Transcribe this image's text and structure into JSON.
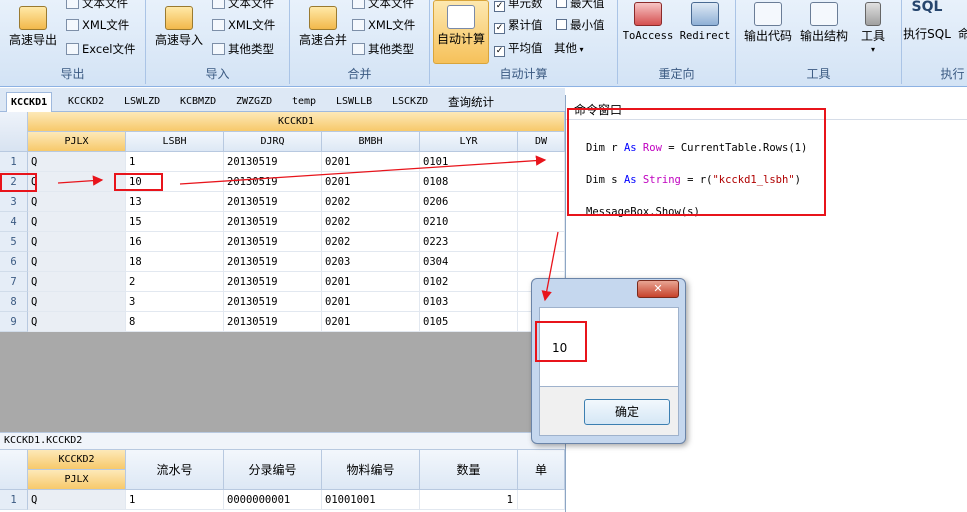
{
  "ribbon": {
    "export": {
      "label": "导出",
      "big": "高速导出",
      "small": [
        "文本文件",
        "XML文件",
        "Excel文件"
      ]
    },
    "import": {
      "label": "导入",
      "big": "高速导入",
      "small": [
        "文本文件",
        "XML文件",
        "其他类型"
      ]
    },
    "merge": {
      "label": "合并",
      "big": "高速合并",
      "small": [
        "文本文件",
        "XML文件",
        "其他类型"
      ]
    },
    "autocalc": {
      "label": "自动计算",
      "big": "自动计算",
      "checks": [
        "单元数",
        "累计值",
        "平均值"
      ],
      "checks2": [
        "最大值",
        "最小值"
      ],
      "other": "其他"
    },
    "redirect": {
      "label": "重定向",
      "buttons": [
        "ToAccess",
        "Redirect"
      ]
    },
    "tools": {
      "label": "工具",
      "buttons": [
        "输出代码",
        "输出结构",
        "工具"
      ]
    },
    "exec": {
      "label": "执行",
      "buttons": [
        "执行SQL",
        "命"
      ],
      "sql_icon": "SQL"
    }
  },
  "tabs": [
    "KCCKD1",
    "KCCKD2",
    "LSWLZD",
    "KCBMZD",
    "ZWZGZD",
    "temp",
    "LSWLLB",
    "LSCKZD",
    "查询统计"
  ],
  "grid1": {
    "group": "KCCKD1",
    "columns": [
      "PJLX",
      "LSBH",
      "DJRQ",
      "BMBH",
      "LYR",
      "DW"
    ],
    "rows": [
      [
        "1",
        "Q",
        "1",
        "20130519",
        "0201",
        "0101"
      ],
      [
        "2",
        "Q",
        "10",
        "20130519",
        "0201",
        "0108"
      ],
      [
        "3",
        "Q",
        "13",
        "20130519",
        "0202",
        "0206"
      ],
      [
        "4",
        "Q",
        "15",
        "20130519",
        "0202",
        "0210"
      ],
      [
        "5",
        "Q",
        "16",
        "20130519",
        "0202",
        "0223"
      ],
      [
        "6",
        "Q",
        "18",
        "20130519",
        "0203",
        "0304"
      ],
      [
        "7",
        "Q",
        "2",
        "20130519",
        "0201",
        "0102"
      ],
      [
        "8",
        "Q",
        "3",
        "20130519",
        "0201",
        "0103"
      ],
      [
        "9",
        "Q",
        "8",
        "20130519",
        "0201",
        "0105"
      ]
    ]
  },
  "relation_label": "KCCKD1.KCCKD2",
  "grid2": {
    "group": "KCCKD2",
    "sub": "PJLX",
    "columns": [
      "流水号",
      "分录编号",
      "物料编号",
      "数量",
      "单"
    ],
    "rows": [
      [
        "1",
        "Q",
        "1",
        "0000000001",
        "01001001",
        "1"
      ]
    ]
  },
  "command_window": {
    "title": "命令窗口",
    "code": [
      [
        "Dim r ",
        "As",
        " ",
        "Row",
        " = CurrentTable.Rows(1)"
      ],
      [
        "Dim s ",
        "As",
        " ",
        "String",
        " = r(",
        "\"kcckd1_lsbh\"",
        ")"
      ],
      [
        "MessageBox.Show(s)"
      ]
    ]
  },
  "messagebox": {
    "text": "10",
    "ok_label": "确定",
    "close": "✕"
  }
}
